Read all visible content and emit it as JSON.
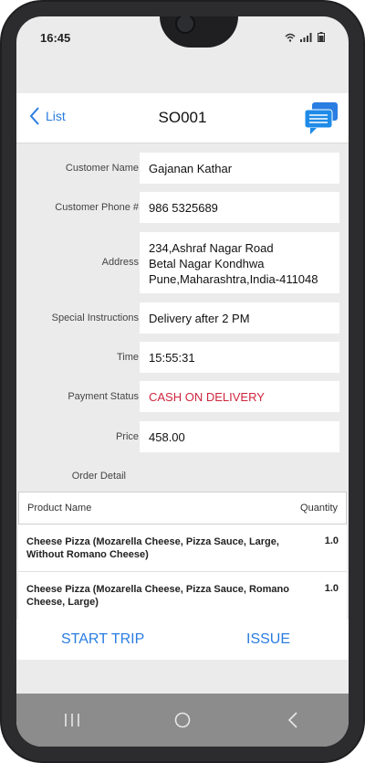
{
  "status_bar": {
    "time": "16:45",
    "icons": [
      "wifi-icon",
      "signal-icon",
      "battery-icon"
    ]
  },
  "header": {
    "back_label": "List",
    "title": "SO001",
    "chat_icon": "chat-bubbles-icon"
  },
  "fields": [
    {
      "label": "Customer Name",
      "value": "Gajanan Kathar"
    },
    {
      "label": "Customer Phone #",
      "value": "986 5325689"
    },
    {
      "label": "Address",
      "lines": [
        "234,Ashraf Nagar Road",
        "Betal Nagar Kondhwa",
        "Pune,Maharashtra,India-411048"
      ]
    },
    {
      "label": "Special Instructions",
      "value": "Delivery after 2 PM"
    },
    {
      "label": "Time",
      "value": "15:55:31"
    },
    {
      "label": "Payment Status",
      "value": "CASH ON DELIVERY"
    },
    {
      "label": "Price",
      "value": "458.00"
    }
  ],
  "order_detail": {
    "label": "Order Detail",
    "columns": [
      "Product Name",
      "Quantity"
    ],
    "rows": [
      {
        "name": "Cheese Pizza (Mozarella Cheese, Pizza Sauce, Large, Without Romano Cheese)",
        "qty": "1.0"
      },
      {
        "name": "Cheese Pizza (Mozarella Cheese, Pizza Sauce, Romano Cheese, Large)",
        "qty": "1.0"
      }
    ]
  },
  "actions": {
    "start_trip": "START TRIP",
    "issue": "ISSUE"
  },
  "colors": {
    "accent": "#2a7de1",
    "payment_status": "#d0253d",
    "nav_bar": "#8c8c8c"
  }
}
